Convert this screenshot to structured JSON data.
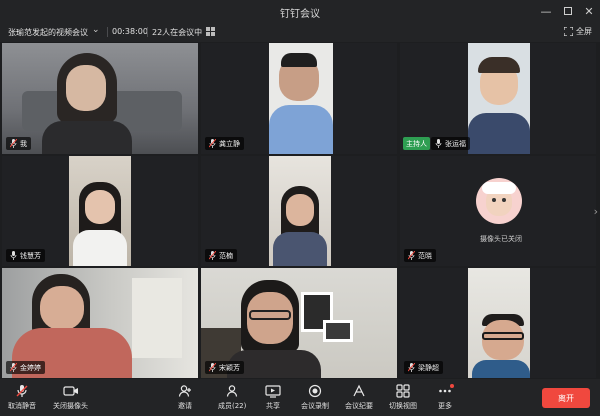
{
  "window": {
    "title": "钉钉会议",
    "controls": [
      "minimize-icon",
      "maximize-icon",
      "close-icon"
    ]
  },
  "infobar": {
    "meeting_title": "张瑜范发起的视频会议",
    "duration": "00:38:00",
    "participants_in_meeting": "22人在会议中",
    "fullscreen_label": "全屏"
  },
  "tiles": [
    {
      "name": "我",
      "mic": "off"
    },
    {
      "name": "龚立静",
      "mic": "off"
    },
    {
      "name": "张运福",
      "mic": "on",
      "host_label": "主持人"
    },
    {
      "name": "钱慧芳",
      "mic": "on"
    },
    {
      "name": "范楠",
      "mic": "off"
    },
    {
      "name": "范晓",
      "mic": "off",
      "camera_off_text": "摄像头已关闭"
    },
    {
      "name": "金婷婷",
      "mic": "off"
    },
    {
      "name": "宋颖芳",
      "mic": "off"
    },
    {
      "name": "梁静超",
      "mic": "off"
    }
  ],
  "toolbar": {
    "unmute": "取消静音",
    "camera_off": "关闭摄像头",
    "invite": "邀请",
    "members": "成员(22)",
    "share": "共享",
    "record": "会议录制",
    "minutes": "会议纪要",
    "switch_view": "切换视图",
    "more": "更多",
    "leave": "离开"
  },
  "colors": {
    "accent_red": "#f0483e",
    "host_green": "#2e9e52",
    "bg": "#1d1e20"
  }
}
